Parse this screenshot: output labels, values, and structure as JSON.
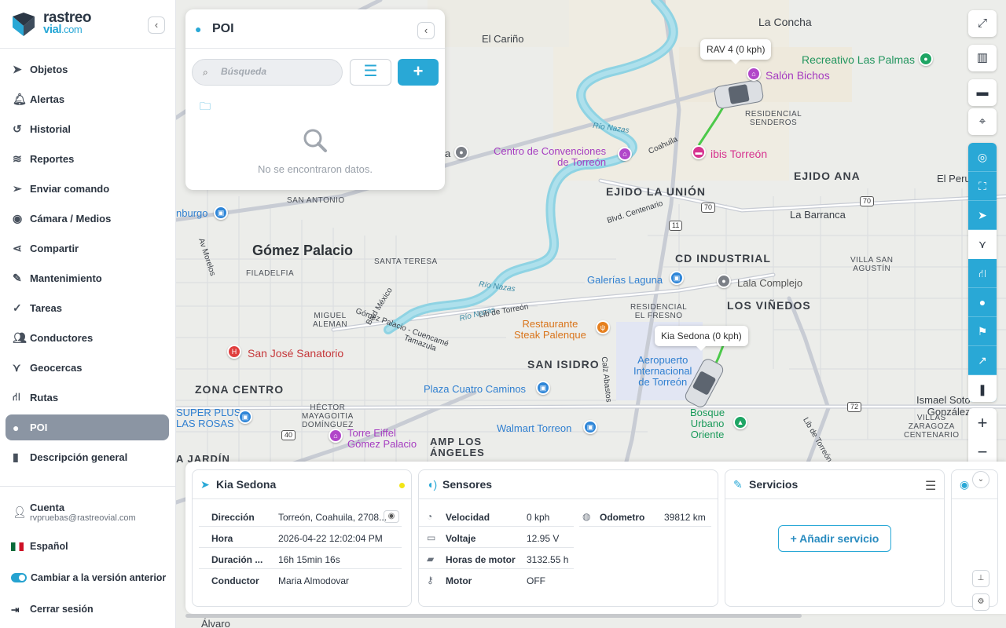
{
  "brand": {
    "line1": "rastreo",
    "line2a": "vial",
    "line2b": ".com"
  },
  "sidebar": {
    "items": [
      {
        "label": "Objetos",
        "icon": "navigation-arrow-icon"
      },
      {
        "label": "Alertas",
        "icon": "bell-icon"
      },
      {
        "label": "Historial",
        "icon": "history-icon"
      },
      {
        "label": "Reportes",
        "icon": "layers-icon"
      },
      {
        "label": "Enviar comando",
        "icon": "send-icon"
      },
      {
        "label": "Cámara / Medios",
        "icon": "camera-icon"
      },
      {
        "label": "Compartir",
        "icon": "share-icon"
      },
      {
        "label": "Mantenimiento",
        "icon": "wrench-icon"
      },
      {
        "label": "Tareas",
        "icon": "checks-icon"
      },
      {
        "label": "Conductores",
        "icon": "users-icon"
      },
      {
        "label": "Geocercas",
        "icon": "geofence-icon"
      },
      {
        "label": "Rutas",
        "icon": "road-icon"
      },
      {
        "label": "POI",
        "icon": "map-pin-icon",
        "active": true
      },
      {
        "label": "Descripción general",
        "icon": "bar-chart-icon"
      }
    ],
    "account": {
      "label": "Cuenta",
      "email": "rvpruebas@rastreovial.com"
    },
    "language": "Español",
    "legacy_toggle": "Cambiar a la versión anterior",
    "logout": "Cerrar sesión"
  },
  "poi_panel": {
    "title": "POI",
    "search_placeholder": "Búsqueda",
    "empty_text": "No se encontraron datos."
  },
  "map": {
    "labels": {
      "la_concha": "La Concha",
      "el_carino": "El Cariño",
      "recreativo": "Recreativo Las Palmas",
      "salon_bichos": "Salón Bichos",
      "residencial_senderos": "RESIDENCIAL\nSENDEROS",
      "ibis": "ibis Torreón",
      "centro_conv": "Centro de Convenciones\nde Torreón",
      "ejido_ana": "EJIDO ANA",
      "el_peru": "El Peru",
      "ejido_union": "EJIDO LA UNIÓN",
      "la_barranca": "La Barranca",
      "san_antonio": "SAN ANTONIO",
      "gomez_palacio": "Gómez Palacio",
      "santa_teresa": "SANTA TERESA",
      "filadelfia": "FILADELFIA",
      "cd_industrial": "CD INDUSTRIAL",
      "villa_san_agustin": "VILLA SAN\nAGUSTÍN",
      "galerias": "Galerías Laguna",
      "lala": "Lala Complejo",
      "los_vinedos": "LOS VIÑEDOS",
      "residencial_fresno": "RESIDENCIAL\nEL FRESNO",
      "miguel_aleman": "MIGUEL\nALEMAN",
      "restaurante": "Restaurante\nSteak Palenque",
      "san_jose": "San José Sanatorio",
      "san_isidro": "SAN ISIDRO",
      "aeropuerto": "Aeropuerto\nInternacional\nde Torreón",
      "zona_centro": "ZONA CENTRO",
      "plaza_cuatro": "Plaza Cuatro Caminos",
      "ismael_soto": "Ismael Soto\nGonzález",
      "villas_zaragoza": "VILLAS\nZARAGOZA\nCENTENARIO",
      "super_plus": "SUPER PLUS\nLAS ROSAS",
      "hector": "HÉCTOR\nMAYAGOITIA\nDOMÍNGUEZ",
      "torre_eiffel": "Torre Eiffel\nGómez Palacio",
      "walmart": "Walmart Torreon",
      "bosque": "Bosque\nUrbano\nOriente",
      "amp_angeles": "AMP LOS\nÁNGELES",
      "jardin": "A JARDÍN",
      "burgo": "nburgo",
      "alvaro": "Álvaro",
      "la_a": "a",
      "rio_nazas1": "Río Nazas",
      "rio_nazas2": "Río Nazas",
      "rio_nazas3": "Río Nazas",
      "coahuila": "Coahuila",
      "blvd_centenario": "Blvd. Centenario",
      "blvd_mexico": "Blvd México",
      "av_morelos": "Av Morelos",
      "lib_torreon": "Lib de Torreón",
      "gomez_cuencame": "Gómez Palacio - Cuencamé",
      "tamazula": "Tamazula",
      "calz_abastos": "Calz Abastos",
      "lib_torreon2": "Lib de Torreón"
    },
    "shields": [
      "70",
      "70",
      "11",
      "40",
      "72"
    ],
    "vehicle_tooltips": [
      "RAV 4 (0 kph)",
      "Kia Sedona (0 kph)"
    ]
  },
  "vehicle": {
    "name": "Kia Sedona",
    "details": [
      {
        "key": "Dirección",
        "value": "Torreón, Coahuila, 2708..."
      },
      {
        "key": "Hora",
        "value": "2026-04-22 12:02:04 PM"
      },
      {
        "key": "Duración ...",
        "value": "16h 15min 16s"
      },
      {
        "key": "Conductor",
        "value": "Maria Almodovar"
      }
    ],
    "status_color": "#f2e516"
  },
  "sensors": {
    "title": "Sensores",
    "left": [
      {
        "key": "Velocidad",
        "value": "0 kph",
        "icon": "speedometer-icon"
      },
      {
        "key": "Voltaje",
        "value": "12.95 V",
        "icon": "battery-icon"
      },
      {
        "key": "Horas de motor",
        "value": "3132.55 h",
        "icon": "engine-icon"
      },
      {
        "key": "Motor",
        "value": "OFF",
        "icon": "key-icon"
      }
    ],
    "right": [
      {
        "key": "Odometro",
        "value": "39812 km",
        "icon": "odometer-icon"
      }
    ]
  },
  "services": {
    "title": "Servicios",
    "add_label": "+ Añadir servicio"
  },
  "colors": {
    "accent": "#29a8d6",
    "sidebar_active": "#8b95a3",
    "route": "#4cc94a",
    "river": "#8fd3e3"
  }
}
